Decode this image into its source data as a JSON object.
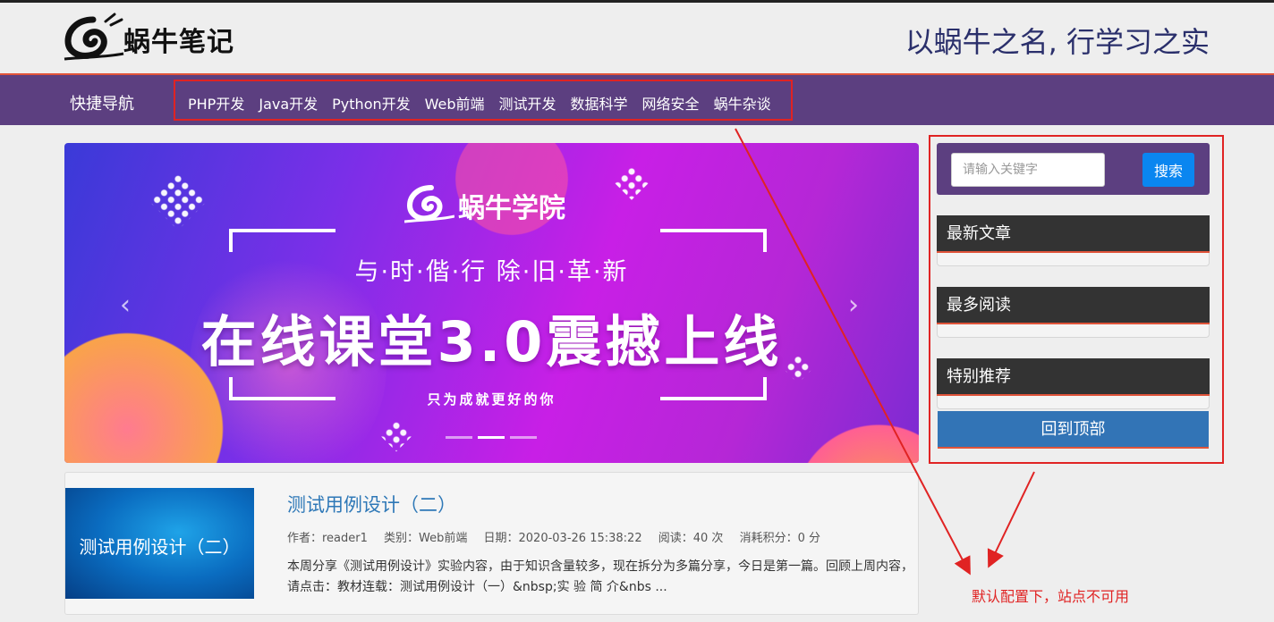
{
  "header": {
    "logo_text": "蜗牛笔记",
    "slogan": "以蜗牛之名, 行学习之实"
  },
  "nav": {
    "title": "快捷导航",
    "links": [
      "PHP开发",
      "Java开发",
      "Python开发",
      "Web前端",
      "测试开发",
      "数据科学",
      "网络安全",
      "蜗牛杂谈"
    ]
  },
  "banner": {
    "brand": "蜗牛学院",
    "line1": "与·时·偕·行   除·旧·革·新",
    "line2": "在线课堂3.0震撼上线",
    "line3": "只为成就更好的你",
    "prev_icon": "‹",
    "next_icon": "›",
    "active_slide": 2,
    "slide_count": 3
  },
  "article": {
    "thumb_text": "测试用例设计（二）",
    "title": "测试用例设计（二）",
    "author": "作者：reader1",
    "category": "类别：Web前端",
    "date": "日期：2020-03-26 15:38:22",
    "reads": "阅读：40 次",
    "cost": "消耗积分：0 分",
    "desc": "本周分享《测试用例设计》实验内容，由于知识含量较多，现在拆分为多篇分享，今日是第一篇。回顾上周内容，请点击：教材连载：测试用例设计（一）&nbsp;实 验 简 介&nbs ..."
  },
  "sidebar": {
    "search_placeholder": "请输入关键字",
    "search_button": "搜索",
    "latest": "最新文章",
    "most_read": "最多阅读",
    "recommended": "特别推荐",
    "back_to_top": "回到顶部"
  },
  "annotation": {
    "text": "默认配置下，站点不可用",
    "color": "#e02323"
  },
  "colors": {
    "nav_bg": "#5c3f80",
    "accent": "#e0543a",
    "link": "#2e78b7",
    "search_button": "#0a86f0",
    "back_top": "#3274b6"
  }
}
